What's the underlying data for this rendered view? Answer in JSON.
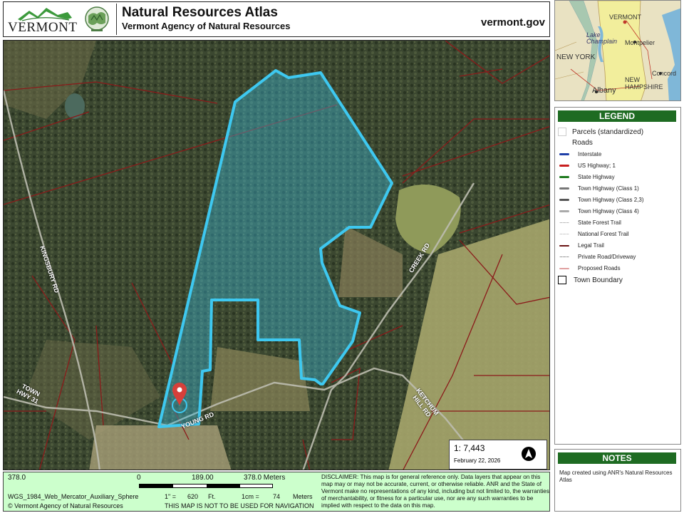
{
  "header": {
    "state_wordmark": "VERMONT",
    "title": "Natural Resources Atlas",
    "subtitle": "Vermont Agency of Natural Resources",
    "site_url": "vermont.gov"
  },
  "locator_map": {
    "labels": [
      "VERMONT",
      "Lake Champlain",
      "Montpelier",
      "NEW YORK",
      "NEW HAMPSHIRE",
      "Concord",
      "Albany"
    ],
    "colors": {
      "land": "#e9e2c2",
      "water": "#7fb7d8",
      "highlight": "#f2ee9c"
    }
  },
  "map": {
    "road_labels": [
      "KINGSBURY RD",
      "CREEK RD",
      "YOUNG RD",
      "KETCHUM HILL RD",
      "TOWN HWY 31"
    ],
    "scale_ratio": "1: 7,443",
    "date": "February 22, 2026",
    "north_arrow_icon": "north-arrow-icon",
    "parcel_outline_color": "#3ec8f0",
    "parcel_fill_color": "#39c1e6",
    "parcel_line_color": "#8b1a1a",
    "marker_color": "#d6403a"
  },
  "legend": {
    "title": "LEGEND",
    "parcels_label": "Parcels (standardized)",
    "roads_label": "Roads",
    "roads": [
      {
        "label": "Interstate",
        "color": "#1f3fa8"
      },
      {
        "label": "US Highway; 1",
        "color": "#c81e1e"
      },
      {
        "label": "State Highway",
        "color": "#1e7a1e"
      },
      {
        "label": "Town Highway (Class 1)",
        "color": "#777777"
      },
      {
        "label": "Town Highway (Class 2,3)",
        "color": "#555555"
      },
      {
        "label": "Town Highway (Class 4)",
        "color": "#aaaaaa"
      },
      {
        "label": "State Forest Trail",
        "color": "#bbbbbb"
      },
      {
        "label": "National Forest Trail",
        "color": "#cccccc"
      },
      {
        "label": "Legal Trail",
        "color": "#6a1414"
      },
      {
        "label": "Private Road/Driveway",
        "color": "#999999"
      },
      {
        "label": "Proposed Roads",
        "color": "#e0a0a0"
      }
    ],
    "town_boundary_label": "Town Boundary"
  },
  "notes": {
    "title": "NOTES",
    "text": "Map created using ANR's Natural Resources Atlas"
  },
  "footer": {
    "scale_left": "378.0",
    "scale_zero": "0",
    "scale_mid": "189.00",
    "scale_right": "378.0 Meters",
    "projection": "WGS_1984_Web_Mercator_Auxiliary_Sphere",
    "inch_label": "1\" =",
    "inch_value": "620",
    "inch_unit": "Ft.",
    "cm_label": "1cm =",
    "cm_value": "74",
    "cm_unit": "Meters",
    "copyright": "© Vermont Agency of Natural Resources",
    "navigation_warning": "THIS MAP IS NOT TO BE USED FOR NAVIGATION",
    "disclaimer": "DISCLAIMER: This map is for general reference only. Data layers that appear on this map may or may not be accurate, current, or otherwise reliable. ANR and the State of Vermont make no representations of any kind, including but not limited to, the warranties of merchantability, or fitness for a particular use, nor are any such warranties to be implied with respect to the data on this map."
  }
}
